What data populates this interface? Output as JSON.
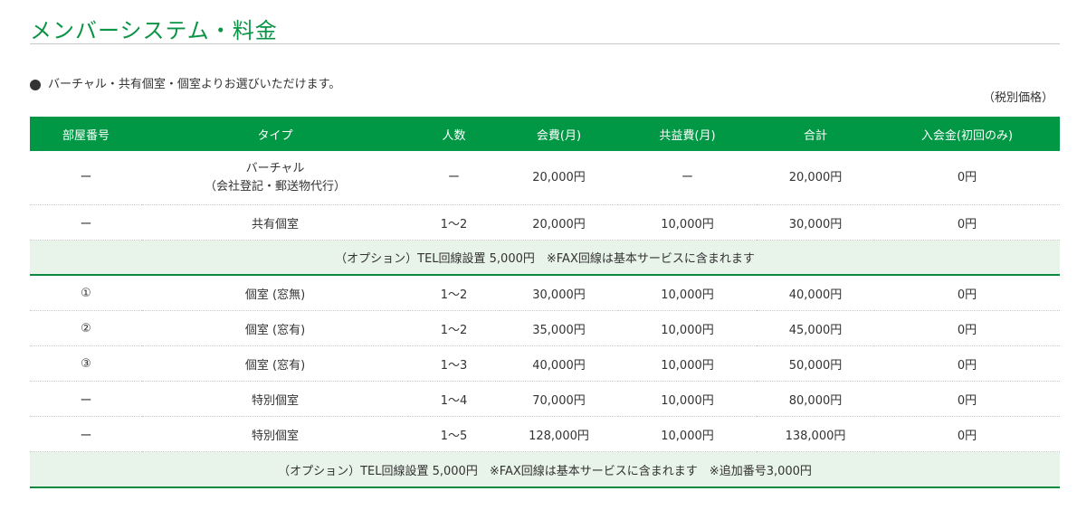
{
  "title": "メンバーシステム・料金",
  "intro": "バーチャル・共有個室・個室よりお選びいただけます。",
  "tax_note": "（税別価格）",
  "columns": [
    "部屋番号",
    "タイプ",
    "人数",
    "会費(月)",
    "共益費(月)",
    "合計",
    "入会金(初回のみ)"
  ],
  "rows": [
    {
      "room": "ー",
      "type_line1": "バーチャル",
      "type_line2": "（会社登記・郵送物代行）",
      "people": "ー",
      "fee": "20,000円",
      "common": "ー",
      "total": "20,000円",
      "entry": "0円"
    },
    {
      "room": "ー",
      "type": "共有個室",
      "people": "1〜2",
      "fee": "20,000円",
      "common": "10,000円",
      "total": "30,000円",
      "entry": "0円"
    },
    {
      "room": "①",
      "type": "個室 (窓無)",
      "people": "1〜2",
      "fee": "30,000円",
      "common": "10,000円",
      "total": "40,000円",
      "entry": "0円"
    },
    {
      "room": "②",
      "type": "個室 (窓有)",
      "people": "1〜2",
      "fee": "35,000円",
      "common": "10,000円",
      "total": "45,000円",
      "entry": "0円"
    },
    {
      "room": "③",
      "type": "個室 (窓有)",
      "people": "1〜3",
      "fee": "40,000円",
      "common": "10,000円",
      "total": "50,000円",
      "entry": "0円"
    },
    {
      "room": "ー",
      "type": "特別個室",
      "people": "1〜4",
      "fee": "70,000円",
      "common": "10,000円",
      "total": "80,000円",
      "entry": "0円"
    },
    {
      "room": "ー",
      "type": "特別個室",
      "people": "1〜5",
      "fee": "128,000円",
      "common": "10,000円",
      "total": "138,000円",
      "entry": "0円"
    }
  ],
  "options": [
    "（オプション）TEL回線設置 5,000円　※FAX回線は基本サービスに含まれます",
    "（オプション）TEL回線設置 5,000円　※FAX回線は基本サービスに含まれます　※追加番号3,000円"
  ],
  "colors": {
    "accent": "#009844",
    "option_bg": "#e8f3ea",
    "fee_zero": "#1b4f8a"
  }
}
